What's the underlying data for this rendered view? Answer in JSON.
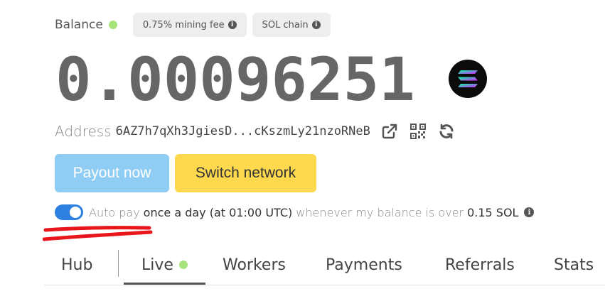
{
  "balance": {
    "label": "Balance",
    "value": "0.00096251",
    "status_color": "#a6e37a"
  },
  "badges": [
    {
      "label": "0.75% mining fee",
      "icon": "info-icon"
    },
    {
      "label": "SOL chain",
      "icon": "info-icon"
    }
  ],
  "address": {
    "label": "Address",
    "value": "6AZ7h7qXh3JgiesD...cKszmLy21nzoRNeB",
    "icons": [
      "external-link-icon",
      "qr-code-icon",
      "refresh-icon"
    ]
  },
  "buttons": {
    "payout": "Payout now",
    "switch_network": "Switch network",
    "payout_color": "#90cdf4",
    "switch_color": "#ffd94d"
  },
  "autopay": {
    "enabled": true,
    "part1": "Auto pay",
    "part2": "once a day (at 01:00 UTC)",
    "part3": "whenever my balance is over",
    "part4": "0.15 SOL",
    "toggle_color": "#2d7fe0"
  },
  "tabs": [
    {
      "label": "Hub"
    },
    {
      "label": "Live",
      "active": true
    },
    {
      "label": "Workers"
    },
    {
      "label": "Payments"
    },
    {
      "label": "Referrals"
    },
    {
      "label": "Stats"
    }
  ]
}
